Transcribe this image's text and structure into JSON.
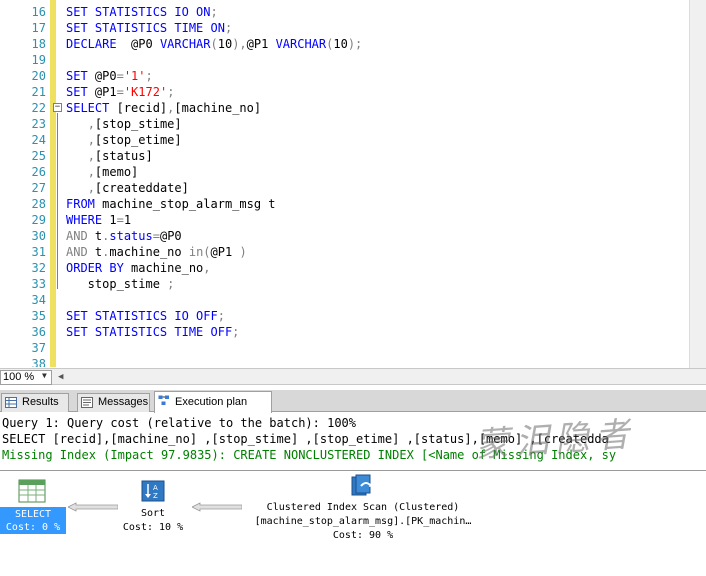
{
  "editor": {
    "lines": [
      {
        "n": "16",
        "segs": [
          [
            "k",
            "SET STATISTICS IO ON"
          ],
          [
            "g",
            ";"
          ]
        ]
      },
      {
        "n": "17",
        "segs": [
          [
            "k",
            "SET STATISTICS TIME ON"
          ],
          [
            "g",
            ";"
          ]
        ]
      },
      {
        "n": "18",
        "segs": [
          [
            "k",
            "DECLARE  "
          ],
          [
            "p",
            "@P0 "
          ],
          [
            "k",
            "VARCHAR"
          ],
          [
            "g",
            "("
          ],
          [
            "p",
            "10"
          ],
          [
            "g",
            "),"
          ],
          [
            "p",
            "@P1 "
          ],
          [
            "k",
            "VARCHAR"
          ],
          [
            "g",
            "("
          ],
          [
            "p",
            "10"
          ],
          [
            "g",
            ");"
          ]
        ]
      },
      {
        "n": "19",
        "segs": []
      },
      {
        "n": "20",
        "segs": [
          [
            "k",
            "SET "
          ],
          [
            "p",
            "@P0"
          ],
          [
            "g",
            "="
          ],
          [
            "s",
            "'1'"
          ],
          [
            "g",
            ";"
          ]
        ]
      },
      {
        "n": "21",
        "segs": [
          [
            "k",
            "SET "
          ],
          [
            "p",
            "@P1"
          ],
          [
            "g",
            "="
          ],
          [
            "s",
            "'K172'"
          ],
          [
            "g",
            ";"
          ]
        ]
      },
      {
        "n": "22",
        "segs": [
          [
            "k",
            "SELECT "
          ],
          [
            "p",
            "[recid]"
          ],
          [
            "g",
            ","
          ],
          [
            "p",
            "[machine_no]"
          ]
        ]
      },
      {
        "n": "23",
        "segs": [
          [
            "p",
            "   "
          ],
          [
            "g",
            ","
          ],
          [
            "p",
            "[stop_stime]"
          ]
        ]
      },
      {
        "n": "24",
        "segs": [
          [
            "p",
            "   "
          ],
          [
            "g",
            ","
          ],
          [
            "p",
            "[stop_etime]"
          ]
        ]
      },
      {
        "n": "25",
        "segs": [
          [
            "p",
            "   "
          ],
          [
            "g",
            ","
          ],
          [
            "p",
            "[status]"
          ]
        ]
      },
      {
        "n": "26",
        "segs": [
          [
            "p",
            "   "
          ],
          [
            "g",
            ","
          ],
          [
            "p",
            "[memo]"
          ]
        ]
      },
      {
        "n": "27",
        "segs": [
          [
            "p",
            "   "
          ],
          [
            "g",
            ","
          ],
          [
            "p",
            "[createddate]"
          ]
        ]
      },
      {
        "n": "28",
        "segs": [
          [
            "k",
            "FROM "
          ],
          [
            "p",
            "machine_stop_alarm_msg t"
          ]
        ]
      },
      {
        "n": "29",
        "segs": [
          [
            "k",
            "WHERE "
          ],
          [
            "p",
            "1"
          ],
          [
            "g",
            "="
          ],
          [
            "p",
            "1"
          ]
        ]
      },
      {
        "n": "30",
        "segs": [
          [
            "g",
            "AND "
          ],
          [
            "p",
            "t"
          ],
          [
            "g",
            "."
          ],
          [
            "k",
            "status"
          ],
          [
            "g",
            "="
          ],
          [
            "p",
            "@P0"
          ]
        ]
      },
      {
        "n": "31",
        "segs": [
          [
            "g",
            "AND "
          ],
          [
            "p",
            "t"
          ],
          [
            "g",
            "."
          ],
          [
            "p",
            "machine_no "
          ],
          [
            "g",
            "in("
          ],
          [
            "p",
            "@P1 "
          ],
          [
            "g",
            ")"
          ]
        ]
      },
      {
        "n": "32",
        "segs": [
          [
            "k",
            "ORDER BY "
          ],
          [
            "p",
            "machine_no"
          ],
          [
            "g",
            ","
          ]
        ]
      },
      {
        "n": "33",
        "segs": [
          [
            "p",
            "   stop_stime "
          ],
          [
            "g",
            ";"
          ]
        ]
      },
      {
        "n": "34",
        "segs": []
      },
      {
        "n": "35",
        "segs": [
          [
            "k",
            "SET STATISTICS IO OFF"
          ],
          [
            "g",
            ";"
          ]
        ]
      },
      {
        "n": "36",
        "segs": [
          [
            "k",
            "SET STATISTICS TIME OFF"
          ],
          [
            "g",
            ";"
          ]
        ]
      },
      {
        "n": "37",
        "segs": []
      },
      {
        "n": "38",
        "segs": []
      }
    ]
  },
  "zoom": {
    "value": "100 %"
  },
  "tabs": [
    {
      "label": "Results"
    },
    {
      "label": "Messages"
    },
    {
      "label": "Execution plan"
    }
  ],
  "plan": {
    "query_header": "Query 1: Query cost (relative to the batch): 100%",
    "query_sql": "SELECT [recid],[machine_no] ,[stop_stime] ,[stop_etime] ,[status],[memo] ,[createdda",
    "missing_index": "Missing Index (Impact 97.9835): CREATE NONCLUSTERED INDEX [<Name of Missing Index, sy",
    "nodes": {
      "select": {
        "name": "SELECT",
        "cost": "Cost: 0 %"
      },
      "sort": {
        "name": "Sort",
        "cost": "Cost: 10 %"
      },
      "scan": {
        "name": "Clustered Index Scan (Clustered)",
        "object": "[machine_stop_alarm_msg].[PK_machin…",
        "cost": "Cost: 90 %"
      }
    }
  },
  "watermark": "蒙泪隐者",
  "colors": {
    "keyword": "#0000ff",
    "string": "#ff0000",
    "operator": "#808080",
    "line_number": "#2b91af",
    "missing_index": "#008000",
    "selected": "#3399ff"
  }
}
